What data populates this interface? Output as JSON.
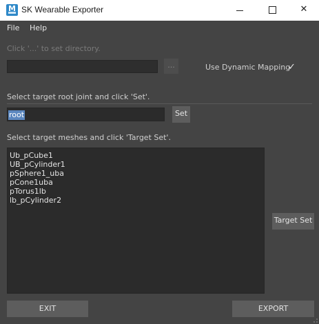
{
  "window": {
    "title": "SK Wearable Exporter",
    "controls": {
      "minimize": "—",
      "maximize": "☐",
      "close": "✕"
    }
  },
  "menu": {
    "items": [
      "File",
      "Help"
    ]
  },
  "directory": {
    "hint": "Click '...' to set directory.",
    "value": "",
    "browse_label": "...",
    "dynamic_mapping_label": "Use Dynamic Mapping",
    "dynamic_mapping_checked": true,
    "check_glyph": "✓"
  },
  "root_joint": {
    "prompt": "Select target root joint and click 'Set'.",
    "value": "root",
    "set_label": "Set"
  },
  "meshes": {
    "prompt": "Select target meshes and click 'Target Set'.",
    "items": [
      "Ub_pCube1",
      "UB_pCylinder1",
      "pSphere1_uba",
      "pCone1uba",
      "pTorus1lb",
      "lb_pCylinder2"
    ],
    "target_set_label": "Target Set"
  },
  "footer": {
    "exit_label": "EXIT",
    "export_label": "EXPORT"
  },
  "colors": {
    "panel": "#444444",
    "field": "#2b2b2b",
    "button": "#5d5d5d",
    "selection": "#5b87bf",
    "icon": "#2e88c8"
  }
}
